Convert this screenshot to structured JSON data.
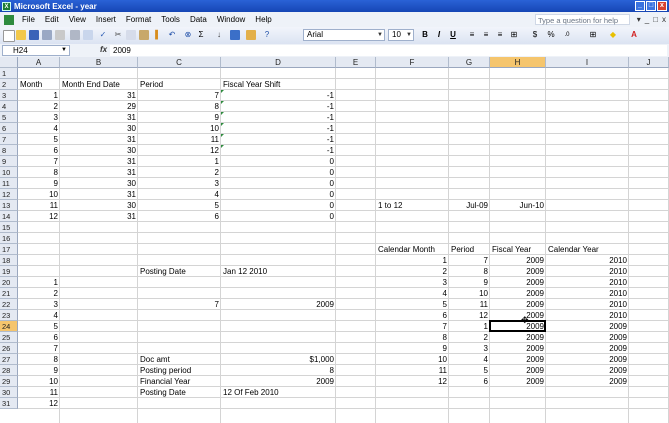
{
  "window": {
    "title": "Microsoft Excel - year",
    "minimize": "_",
    "maximize": "□",
    "close": "x"
  },
  "menubar": {
    "items": [
      "File",
      "Edit",
      "View",
      "Insert",
      "Format",
      "Tools",
      "Data",
      "Window",
      "Help"
    ],
    "help_placeholder": "Type a question for help",
    "doc_controls": [
      "▾",
      "_",
      "□",
      "x"
    ]
  },
  "toolbar": {
    "font_name": "Arial",
    "font_size": "10",
    "bold": "B",
    "italic": "I",
    "underline": "U",
    "currency": "$",
    "percent": "%",
    "sigma": "Σ",
    "sort": "↓"
  },
  "formula_bar": {
    "name_box": "H24",
    "fx": "fx",
    "value": "2009"
  },
  "sheet": {
    "columns": [
      "A",
      "B",
      "C",
      "D",
      "E",
      "F",
      "G",
      "H",
      "I",
      "J"
    ],
    "selected_column": "H",
    "selected_row": 24,
    "rows": [
      1,
      2,
      3,
      4,
      5,
      6,
      7,
      8,
      9,
      10,
      11,
      12,
      13,
      14,
      15,
      16,
      17,
      18,
      19,
      20,
      21,
      22,
      23,
      24,
      25,
      26,
      27,
      28,
      29,
      30,
      31
    ],
    "cells": {
      "A2": "Month",
      "B2": "Month End Date",
      "C2": "Period",
      "D2": "Fiscal Year Shift",
      "A3": "1",
      "B3": "31",
      "C3": "7",
      "D3": "-1",
      "A4": "2",
      "B4": "29",
      "C4": "8",
      "D4": "-1",
      "A5": "3",
      "B5": "31",
      "C5": "9",
      "D5": "-1",
      "A6": "4",
      "B6": "30",
      "C6": "10",
      "D6": "-1",
      "A7": "5",
      "B7": "31",
      "C7": "11",
      "D7": "-1",
      "A8": "6",
      "B8": "30",
      "C8": "12",
      "D8": "-1",
      "A9": "7",
      "B9": "31",
      "C9": "1",
      "D9": "0",
      "A10": "8",
      "B10": "31",
      "C10": "2",
      "D10": "0",
      "A11": "9",
      "B11": "30",
      "C11": "3",
      "D11": "0",
      "A12": "10",
      "B12": "31",
      "C12": "4",
      "D12": "0",
      "A13": "11",
      "B13": "30",
      "C13": "5",
      "D13": "0",
      "A14": "12",
      "B14": "31",
      "C14": "6",
      "D14": "0",
      "F13": "1 to 12",
      "G13": "Jul-09",
      "H13": "Jun-10",
      "F17": "Calendar Month",
      "G17": "Period",
      "H17": "Fiscal Year",
      "I17": "Calendar Year",
      "F18": "1",
      "G18": "7",
      "H18": "2009",
      "I18": "2010",
      "C19": "Posting Date",
      "D19": "Jan 12 2010",
      "F19": "2",
      "G19": "8",
      "H19": "2009",
      "I19": "2010",
      "A20": "1",
      "F20": "3",
      "G20": "9",
      "H20": "2009",
      "I20": "2010",
      "A21": "2",
      "F21": "4",
      "G21": "10",
      "H21": "2009",
      "I21": "2010",
      "A22": "3",
      "C22": "7",
      "D22": "2009",
      "F22": "5",
      "G22": "11",
      "H22": "2009",
      "I22": "2010",
      "A23": "4",
      "F23": "6",
      "G23": "12",
      "H23": "2009",
      "I23": "2010",
      "A24": "5",
      "F24": "7",
      "G24": "1",
      "H24": "2009",
      "I24": "2009",
      "A25": "6",
      "F25": "8",
      "G25": "2",
      "H25": "2009",
      "I25": "2009",
      "A26": "7",
      "F26": "9",
      "G26": "3",
      "H26": "2009",
      "I26": "2009",
      "A27": "8",
      "C27": "Doc amt",
      "D27": "$1,000",
      "F27": "10",
      "G27": "4",
      "H27": "2009",
      "I27": "2009",
      "A28": "9",
      "C28": "Posting period",
      "D28": "8",
      "F28": "11",
      "G28": "5",
      "H28": "2009",
      "I28": "2009",
      "A29": "10",
      "C29": "Financial Year",
      "D29": "2009",
      "F29": "12",
      "G29": "6",
      "H29": "2009",
      "I29": "2009",
      "A30": "11",
      "C30": "Posting Date",
      "D30": "12 Of Feb 2010",
      "A31": "12"
    },
    "left_aligned": [
      "A2",
      "B2",
      "C2",
      "D2",
      "F13",
      "F17",
      "G17",
      "H17",
      "I17",
      "C19",
      "D19",
      "C27",
      "C28",
      "C29",
      "C30",
      "D30"
    ],
    "green_markers": [
      "D3",
      "D4",
      "D5",
      "D6",
      "D7",
      "D8"
    ]
  }
}
